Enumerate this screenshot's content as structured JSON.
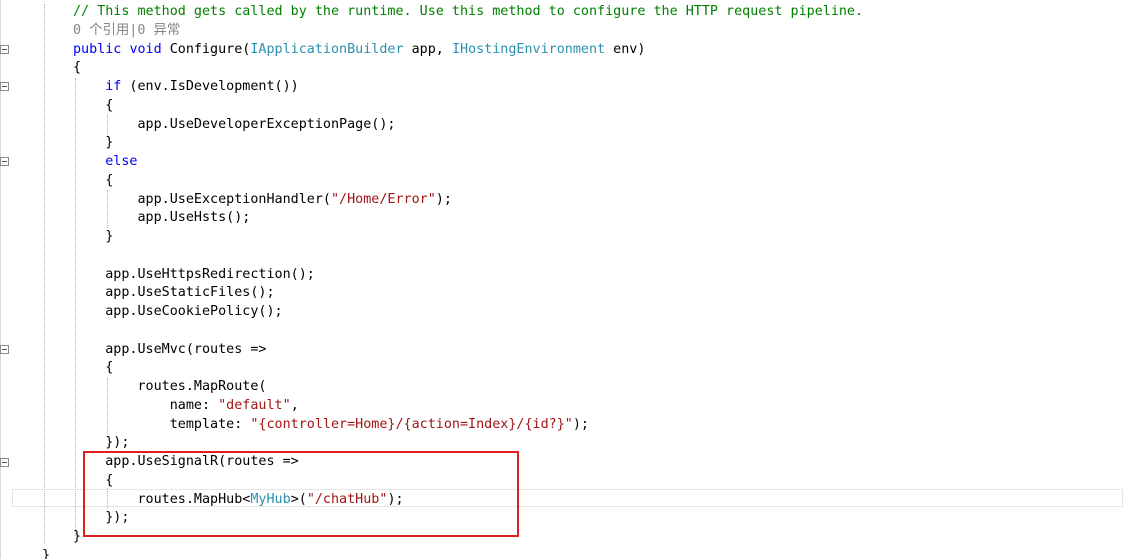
{
  "editor": {
    "lines": [
      [
        {
          "t": "// This method gets called by the runtime. Use this method to configure the HTTP request pipeline.",
          "c": "c"
        }
      ],
      [
        {
          "t": "0 个引用|0 异常",
          "c": "lens"
        }
      ],
      [
        {
          "t": "public",
          "c": "k"
        },
        {
          "t": " "
        },
        {
          "t": "void",
          "c": "k"
        },
        {
          "t": " Configure("
        },
        {
          "t": "IApplicationBuilder",
          "c": "t"
        },
        {
          "t": " app, "
        },
        {
          "t": "IHostingEnvironment",
          "c": "t"
        },
        {
          "t": " env)"
        }
      ],
      [
        {
          "t": "{"
        }
      ],
      [
        {
          "t": "    "
        },
        {
          "t": "if",
          "c": "k"
        },
        {
          "t": " (env.IsDevelopment())"
        }
      ],
      [
        {
          "t": "    {"
        }
      ],
      [
        {
          "t": "        app.UseDeveloperExceptionPage();"
        }
      ],
      [
        {
          "t": "    }"
        }
      ],
      [
        {
          "t": "    "
        },
        {
          "t": "else",
          "c": "k"
        }
      ],
      [
        {
          "t": "    {"
        }
      ],
      [
        {
          "t": "        app.UseExceptionHandler("
        },
        {
          "t": "\"/Home/Error\"",
          "c": "s"
        },
        {
          "t": ");"
        }
      ],
      [
        {
          "t": "        app.UseHsts();"
        }
      ],
      [
        {
          "t": "    }"
        }
      ],
      [
        {
          "t": ""
        }
      ],
      [
        {
          "t": "    app.UseHttpsRedirection();"
        }
      ],
      [
        {
          "t": "    app.UseStaticFiles();"
        }
      ],
      [
        {
          "t": "    app.UseCookiePolicy();"
        }
      ],
      [
        {
          "t": ""
        }
      ],
      [
        {
          "t": "    app.UseMvc(routes =>"
        }
      ],
      [
        {
          "t": "    {"
        }
      ],
      [
        {
          "t": "        routes.MapRoute("
        }
      ],
      [
        {
          "t": "            name: "
        },
        {
          "t": "\"default\"",
          "c": "s"
        },
        {
          "t": ","
        }
      ],
      [
        {
          "t": "            template: "
        },
        {
          "t": "\"{controller=Home}/{action=Index}/{id?}\"",
          "c": "s"
        },
        {
          "t": ");"
        }
      ],
      [
        {
          "t": "    });"
        }
      ],
      [
        {
          "t": "    app.UseSignalR(routes =>"
        }
      ],
      [
        {
          "t": "    {"
        }
      ],
      [
        {
          "t": "        routes.MapHub<"
        },
        {
          "t": "MyHub",
          "c": "t"
        },
        {
          "t": ">("
        },
        {
          "t": "\"/chatHub\"",
          "c": "s"
        },
        {
          "t": ");"
        }
      ],
      [
        {
          "t": "    });"
        }
      ],
      [
        {
          "t": "}"
        }
      ],
      [
        {
          "t": "}"
        }
      ]
    ]
  }
}
